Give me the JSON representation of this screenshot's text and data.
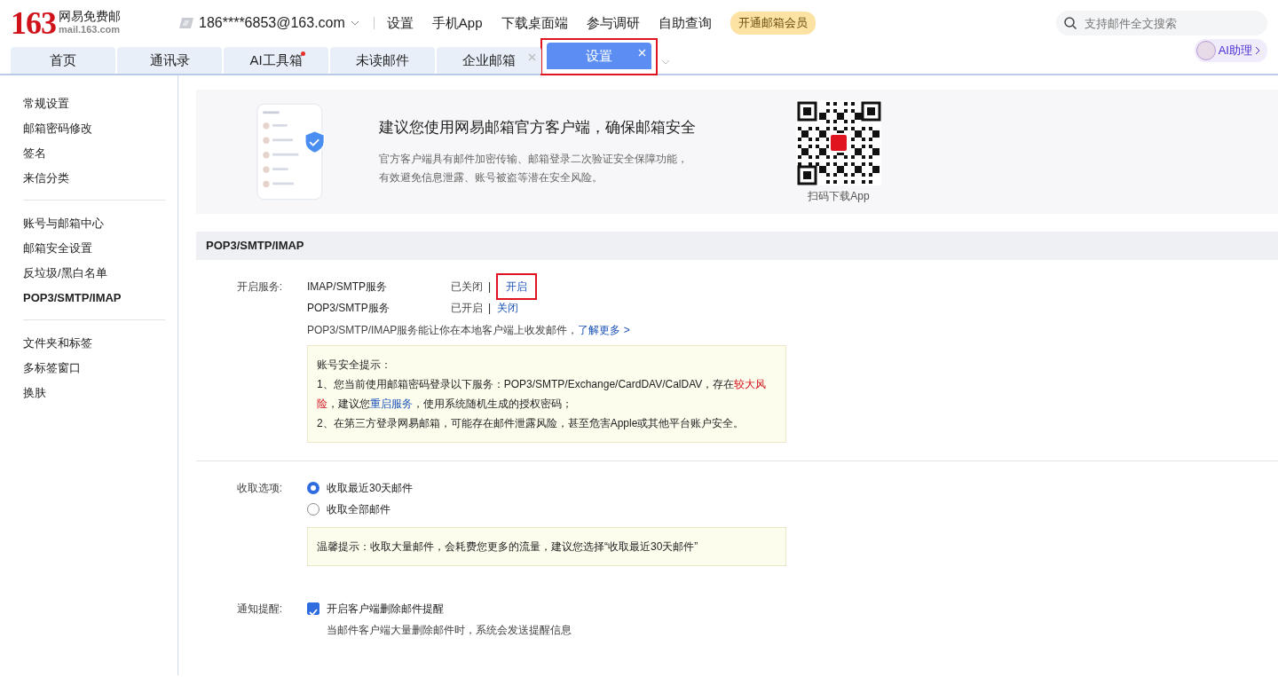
{
  "header": {
    "logo_number": "163",
    "logo_name": "网易免费邮",
    "logo_domain": "mail.163.com",
    "account": "186****6853@163.com",
    "links": [
      "设置",
      "手机App",
      "下载桌面端",
      "参与调研",
      "自助查询"
    ],
    "vip_badge": "开通邮箱会员",
    "search": {
      "placeholder": "支持邮件全文搜索"
    },
    "ai_assistant": "AI助理"
  },
  "tabs": [
    {
      "label": "首页",
      "selected": false,
      "dot": false,
      "closable": false,
      "highlighted": false
    },
    {
      "label": "通讯录",
      "selected": false,
      "dot": false,
      "closable": false,
      "highlighted": false
    },
    {
      "label": "AI工具箱",
      "selected": false,
      "dot": true,
      "closable": false,
      "highlighted": false
    },
    {
      "label": "未读邮件",
      "selected": false,
      "dot": false,
      "closable": false,
      "highlighted": false
    },
    {
      "label": "企业邮箱",
      "selected": false,
      "dot": false,
      "closable": true,
      "highlighted": false
    },
    {
      "label": "设置",
      "selected": true,
      "dot": false,
      "closable": true,
      "highlighted": true
    }
  ],
  "sidebar": {
    "groups": [
      [
        {
          "label": "常规设置",
          "selected": false
        },
        {
          "label": "邮箱密码修改",
          "selected": false
        },
        {
          "label": "签名",
          "selected": false
        },
        {
          "label": "来信分类",
          "selected": false
        }
      ],
      [
        {
          "label": "账号与邮箱中心",
          "selected": false
        },
        {
          "label": "邮箱安全设置",
          "selected": false
        },
        {
          "label": "反垃圾/黑白名单",
          "selected": false
        },
        {
          "label": "POP3/SMTP/IMAP",
          "selected": true
        }
      ],
      [
        {
          "label": "文件夹和标签",
          "selected": false
        },
        {
          "label": "多标签窗口",
          "selected": false
        },
        {
          "label": "换肤",
          "selected": false
        }
      ]
    ]
  },
  "banner": {
    "title": "建议您使用网易邮箱官方客户端，确保邮箱安全",
    "text": "官方客户端具有邮件加密传输、邮箱登录二次验证安全保障功能，有效避免信息泄露、账号被盗等潜在安全风险。",
    "qr_caption": "扫码下载App"
  },
  "section": {
    "title": "POP3/SMTP/IMAP",
    "services_label": "开启服务:",
    "services": [
      {
        "name": "IMAP/SMTP服务",
        "status": "已关闭",
        "separator": "|",
        "action": "开启",
        "highlighted": true
      },
      {
        "name": "POP3/SMTP服务",
        "status": "已开启",
        "separator": "|",
        "action": "关闭",
        "highlighted": false
      }
    ],
    "services_note": "POP3/SMTP/IMAP服务能让你在本地客户端上收发邮件，",
    "learn_more": "了解更多 >",
    "warning": {
      "title": "账号安全提示：",
      "lines": [
        [
          {
            "kind": "plain",
            "text": "1、您当前使用邮箱密码登录以下服务：POP3/SMTP/Exchange/CardDAV/CalDAV，存在"
          },
          {
            "kind": "risk",
            "text": "较大风险"
          },
          {
            "kind": "plain",
            "text": "，建议您"
          },
          {
            "kind": "link",
            "text": "重启服务"
          },
          {
            "kind": "plain",
            "text": "，使用系统随机生成的授权密码；"
          }
        ],
        [
          {
            "kind": "plain",
            "text": "2、在第三方登录网易邮箱，可能存在邮件泄露风险，甚至危害Apple或其他平台账户安全。"
          }
        ]
      ]
    },
    "fetch_label": "收取选项:",
    "fetch_options": [
      {
        "label": "收取最近30天邮件",
        "selected": true
      },
      {
        "label": "收取全部邮件",
        "selected": false
      }
    ],
    "fetch_tip": "温馨提示：收取大量邮件，会耗费您更多的流量，建议您选择“收取最近30天邮件”",
    "notify_label": "通知提醒:",
    "notify": {
      "label": "开启客户端删除邮件提醒",
      "checked": true,
      "note": "当邮件客户端大量删除邮件时，系统会发送提醒信息"
    }
  }
}
